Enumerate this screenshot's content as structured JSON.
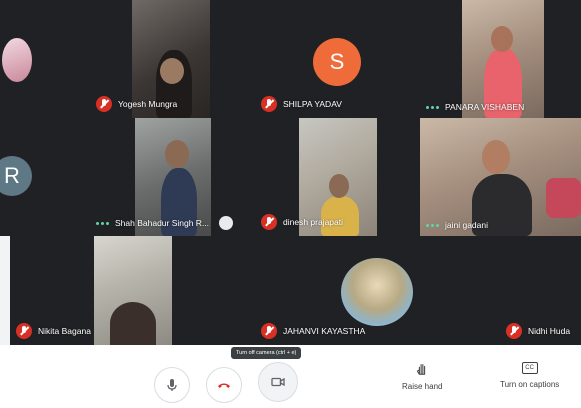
{
  "participants": [
    {
      "name": "Yogesh Mungra",
      "status": "muted"
    },
    {
      "name": "SHILPA YADAV",
      "status": "muted",
      "avatar_letter": "S",
      "avatar_color": "#ef6c3a"
    },
    {
      "name": "PANARA VISHABEN",
      "status": "speaking"
    },
    {
      "name": "Shah Bahadur Singh R...",
      "status": "speaking"
    },
    {
      "name": "dinesh prajapati",
      "status": "muted"
    },
    {
      "name": "jaini gadani",
      "status": "speaking"
    },
    {
      "name": "Nikita Bagana",
      "status": "muted"
    },
    {
      "name": "JAHANVI KAYASTHA",
      "status": "muted"
    },
    {
      "name": "Nidhi Huda",
      "status": "muted"
    }
  ],
  "left_avatar": {
    "letter": "R",
    "color": "#5f7885"
  },
  "controls": {
    "tooltip": "Turn off camera (ctrl + e)",
    "raise_hand_label": "Raise hand",
    "captions_label": "Turn on captions",
    "captions_icon_text": "CC"
  },
  "colors": {
    "muted_red": "#d93025",
    "speaking_green": "#5fd4a8",
    "end_call_red": "#d93025"
  }
}
